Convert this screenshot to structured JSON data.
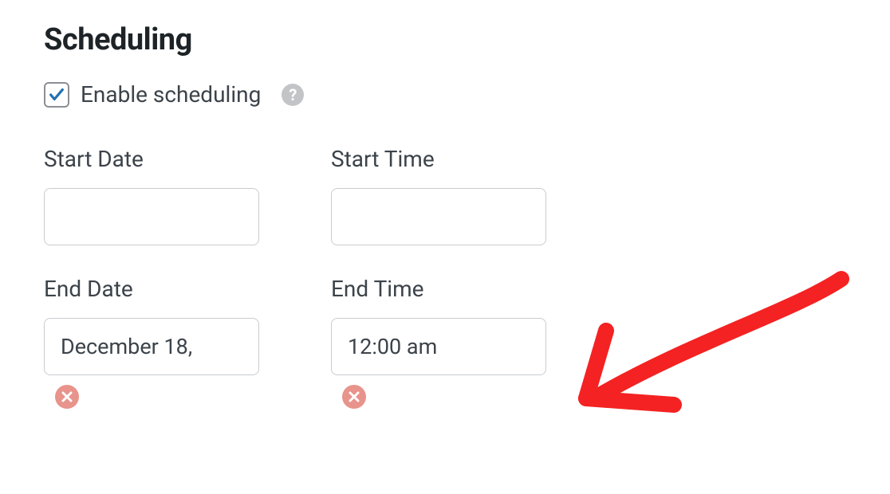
{
  "section": {
    "title": "Scheduling"
  },
  "enable": {
    "label": "Enable scheduling",
    "checked": true
  },
  "fields": {
    "start_date": {
      "label": "Start Date",
      "value": ""
    },
    "start_time": {
      "label": "Start Time",
      "value": ""
    },
    "end_date": {
      "label": "End Date",
      "value": "December 18,"
    },
    "end_time": {
      "label": "End Time",
      "value": "12:00 am"
    }
  },
  "colors": {
    "checkmark": "#2271b1",
    "clear_button": "#e8938b",
    "annotation": "#f42222"
  }
}
